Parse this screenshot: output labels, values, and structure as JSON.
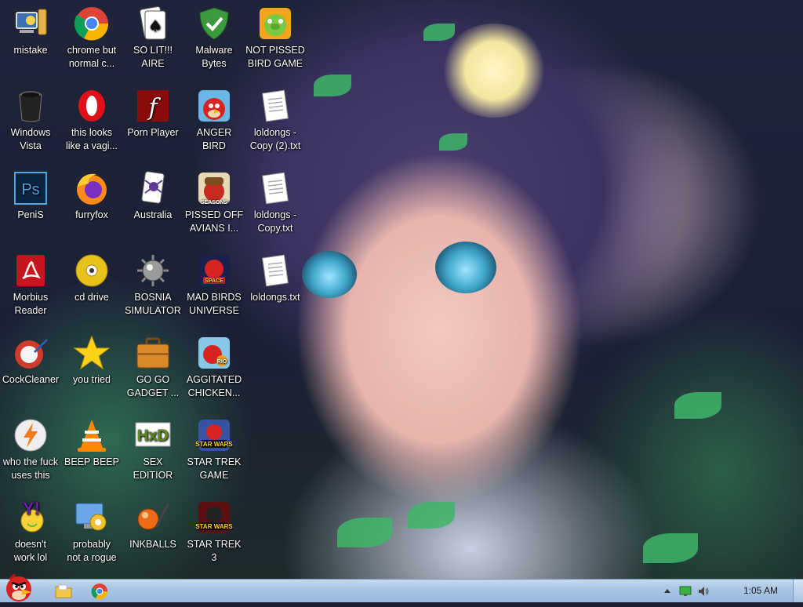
{
  "desktop": {
    "icons": [
      {
        "label": "mistake",
        "icon": "computer-icon"
      },
      {
        "label": "chrome but\nnormal c...",
        "icon": "chrome-icon"
      },
      {
        "label": "SO LIT!!!\nAIRE",
        "icon": "solitaire-icon"
      },
      {
        "label": "Malware\nBytes",
        "icon": "shield-icon"
      },
      {
        "label": "NOT PISSED\nBIRD GAME",
        "icon": "pig-icon"
      },
      {
        "label": "Windows\nVista",
        "icon": "recycle-bin-icon"
      },
      {
        "label": "this looks\nlike a vagi...",
        "icon": "opera-icon"
      },
      {
        "label": "Porn Player",
        "icon": "flash-icon"
      },
      {
        "label": "ANGER\nBIRD",
        "icon": "angry-bird-icon"
      },
      {
        "label": "loldongs -\nCopy (2).txt",
        "icon": "text-file-icon"
      },
      {
        "label": "PeniS",
        "icon": "photoshop-icon"
      },
      {
        "label": "furryfox",
        "icon": "firefox-icon"
      },
      {
        "label": "Australia",
        "icon": "spider-solitaire-icon"
      },
      {
        "label": "PISSED OFF\nAVIANS I...",
        "icon": "angry-birds-seasons-icon"
      },
      {
        "label": "loldongs -\nCopy.txt",
        "icon": "text-file-icon"
      },
      {
        "label": "Morbius\nReader",
        "icon": "pdf-reader-icon"
      },
      {
        "label": "cd drive",
        "icon": "cd-icon"
      },
      {
        "label": "BOSNIA\nSIMULATOR",
        "icon": "mine-icon"
      },
      {
        "label": "MAD BIRDS\nUNIVERSE",
        "icon": "angry-birds-space-icon"
      },
      {
        "label": "loldongs.txt",
        "icon": "text-file-icon"
      },
      {
        "label": "CockCleaner",
        "icon": "ccleaner-icon"
      },
      {
        "label": "you tried",
        "icon": "star-icon"
      },
      {
        "label": "GO GO\nGADGET ...",
        "icon": "briefcase-icon"
      },
      {
        "label": "AGGITATED\nCHICKEN...",
        "icon": "angry-birds-rio-icon"
      },
      {
        "label": "who the fuck\nuses this",
        "icon": "winamp-icon"
      },
      {
        "label": "BEEP BEEP",
        "icon": "vlc-icon"
      },
      {
        "label": "SEX\nEDITIOR",
        "icon": "hxd-icon"
      },
      {
        "label": "STAR TREK\nGAME",
        "icon": "angry-birds-star-wars-icon"
      },
      {
        "label": "doesn't\nwork lol",
        "icon": "yahoo-messenger-icon"
      },
      {
        "label": "probably\nnot a rogue",
        "icon": "control-panel-icon"
      },
      {
        "label": "INKBALLS",
        "icon": "inkball-icon"
      },
      {
        "label": "STAR TREK\n3",
        "icon": "angry-birds-star-wars-2-icon"
      }
    ]
  },
  "taskbar": {
    "pinned": [
      {
        "icon": "angry-bird-start-icon"
      },
      {
        "icon": "folder-icon"
      },
      {
        "icon": "chrome-icon"
      }
    ],
    "tray_icons": [
      "show-hidden-icons-arrow",
      "network-icon",
      "volume-icon"
    ],
    "clock": "1:05 AM"
  }
}
